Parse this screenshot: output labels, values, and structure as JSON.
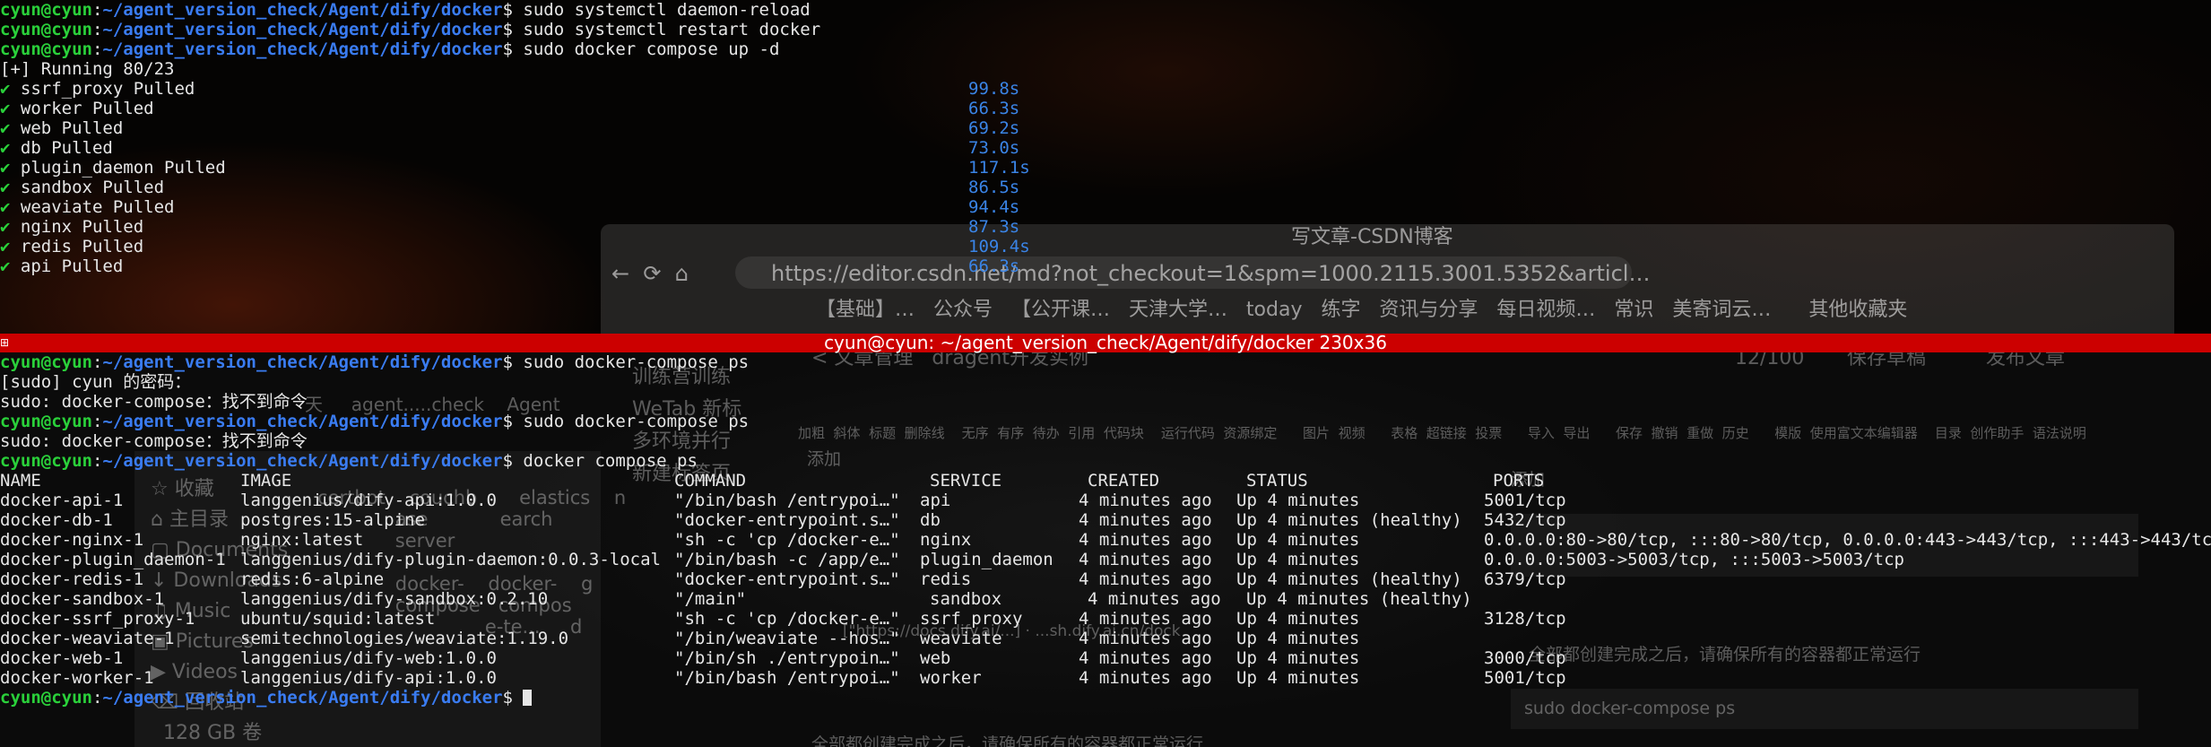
{
  "prompt": {
    "user": "cyun@cyun",
    "path": "~/agent_version_check/Agent/dify/docker",
    "sep": ":",
    "sigil": "$ "
  },
  "top_terminal": {
    "commands": [
      "sudo systemctl daemon-reload",
      "sudo systemctl restart docker",
      "sudo docker compose up -d"
    ],
    "running": "[+] Running 80/23",
    "pulled": [
      {
        "name": "ssrf_proxy Pulled",
        "time": "99.8s"
      },
      {
        "name": "worker Pulled",
        "time": "66.3s"
      },
      {
        "name": "web Pulled",
        "time": "69.2s"
      },
      {
        "name": "db Pulled",
        "time": "73.0s"
      },
      {
        "name": "plugin_daemon Pulled",
        "time": "117.1s"
      },
      {
        "name": "sandbox Pulled",
        "time": "86.5s"
      },
      {
        "name": "weaviate Pulled",
        "time": "94.4s"
      },
      {
        "name": "nginx Pulled",
        "time": "87.3s"
      },
      {
        "name": "redis Pulled",
        "time": "109.4s"
      },
      {
        "name": "api Pulled",
        "time": "66.3s"
      }
    ],
    "check_glyph": "✔"
  },
  "window": {
    "title": "cyun@cyun: ~/agent_version_check/Agent/dify/docker 230x36",
    "grip": "⊞"
  },
  "bottom_terminal": {
    "cmd1": "sudo docker-compose ps",
    "sudo_prompt": "[sudo] cyun 的密码：",
    "err1": "sudo: docker-compose：找不到命令",
    "cmd2": "sudo docker-compose ps",
    "err2": "sudo: docker-compose：找不到命令",
    "cmd3": "docker compose ps",
    "headers": {
      "name": "NAME",
      "image": "IMAGE",
      "command": "COMMAND",
      "service": "SERVICE",
      "created": "CREATED",
      "status": "STATUS",
      "ports": "PORTS"
    },
    "rows": [
      {
        "name": "docker-api-1",
        "image": "langgenius/dify-api:1.0.0",
        "command": "\"/bin/bash /entrypoi…\"",
        "service": "api",
        "created": "4 minutes ago",
        "status": "Up 4 minutes",
        "ports": "5001/tcp"
      },
      {
        "name": "docker-db-1",
        "image": "postgres:15-alpine",
        "command": "\"docker-entrypoint.s…\"",
        "service": "db",
        "created": "4 minutes ago",
        "status": "Up 4 minutes (healthy)",
        "ports": "5432/tcp"
      },
      {
        "name": "docker-nginx-1",
        "image": "nginx:latest",
        "command": "\"sh -c 'cp /docker-e…\"",
        "service": "nginx",
        "created": "4 minutes ago",
        "status": "Up 4 minutes",
        "ports": "0.0.0.0:80->80/tcp, :::80->80/tcp, 0.0.0.0:443->443/tcp, :::443->443/tcp"
      },
      {
        "name": "docker-plugin_daemon-1",
        "image": "langgenius/dify-plugin-daemon:0.0.3-local",
        "command": "\"/bin/bash -c /app/e…\"",
        "service": "plugin_daemon",
        "created": "4 minutes ago",
        "status": "Up 4 minutes",
        "ports": "0.0.0.0:5003->5003/tcp, :::5003->5003/tcp"
      },
      {
        "name": "docker-redis-1",
        "image": "redis:6-alpine",
        "command": "\"docker-entrypoint.s…\"",
        "service": "redis",
        "created": "4 minutes ago",
        "status": "Up 4 minutes (healthy)",
        "ports": "6379/tcp"
      },
      {
        "name": "docker-sandbox-1",
        "image": "langgenius/dify-sandbox:0.2.10",
        "command": "\"/main\"",
        "service": "sandbox",
        "created": "4 minutes ago",
        "status": "Up 4 minutes (healthy)",
        "ports": ""
      },
      {
        "name": "docker-ssrf_proxy-1",
        "image": "ubuntu/squid:latest",
        "command": "\"sh -c 'cp /docker-e…\"",
        "service": "ssrf_proxy",
        "created": "4 minutes ago",
        "status": "Up 4 minutes",
        "ports": "3128/tcp"
      },
      {
        "name": "docker-weaviate-1",
        "image": "semitechnologies/weaviate:1.19.0",
        "command": "\"/bin/weaviate --hos…\"",
        "service": "weaviate",
        "created": "4 minutes ago",
        "status": "Up 4 minutes",
        "ports": ""
      },
      {
        "name": "docker-web-1",
        "image": "langgenius/dify-web:1.0.0",
        "command": "\"/bin/sh ./entrypoin…\"",
        "service": "web",
        "created": "4 minutes ago",
        "status": "Up 4 minutes",
        "ports": "3000/tcp"
      },
      {
        "name": "docker-worker-1",
        "image": "langgenius/dify-api:1.0.0",
        "command": "\"/bin/bash /entrypoi…\"",
        "service": "worker",
        "created": "4 minutes ago",
        "status": "Up 4 minutes",
        "ports": "5001/tcp"
      }
    ]
  },
  "background_browser": {
    "title": "写文章-CSDN博客",
    "url": "https://editor.csdn.net/md?not_checkout=1&spm=1000.2115.3001.5352&articl…",
    "nav_icons": "←  ⟳  ⌂",
    "bookmarks": "【基础】…   公众号   【公开课…   天津大学…   today   练字   资讯与分享   每日视频…   常识   美寄词云…      其他收藏夹"
  },
  "background_editor": {
    "side_items": "训练营训练\nWeTab 新标\n多环境并行\n新建标签页",
    "back_link": "< 文章管理   dragent开发实例",
    "counter": "12/100",
    "save_draft": "保存草稿",
    "publish": "发布文章",
    "toolbar": "加粗  斜体  标题  删除线    无序  有序  待办  引用  代码块    运行代码  资源绑定      图片  视频      表格  超链接  投票      导入  导出      保存  撤销  重做  历史      模版  使用富文本编辑器    目录  创作助手  语法说明",
    "add_label": "添加",
    "preview_add": "添加",
    "preview_text": "全部都创建完成之后，请确保所有的容器都正常运行",
    "preview_code": "sudo docker-compose ps",
    "doc_link": "[\"https://docs.dify.ai/...] · ...sh.dify.ai.cn/dock",
    "bottom_text": "全部都创建完成之后，请确保所有的容器都正常运行"
  },
  "background_files": {
    "sidebar": "☆ 收藏\n⌂ 主目录\n▢ Documents\n↓ Downloads\n♫ Music\n▣ Pictures\n▶ Videos\n⌫ 回收站\n  128 GB 卷",
    "icons": "certbot    couchb       elastics    n\n             ase            earch\n             server\n\n             docker-    docker-    g\n             compose   compos\n                            e-te...     d",
    "folder_tabs": "天     agent.....check    Agent"
  },
  "colors": {
    "prompt_user": "#2ad03a",
    "prompt_path": "#3a7cf2",
    "title_bar": "#cc0000",
    "time": "#3a84e6"
  }
}
